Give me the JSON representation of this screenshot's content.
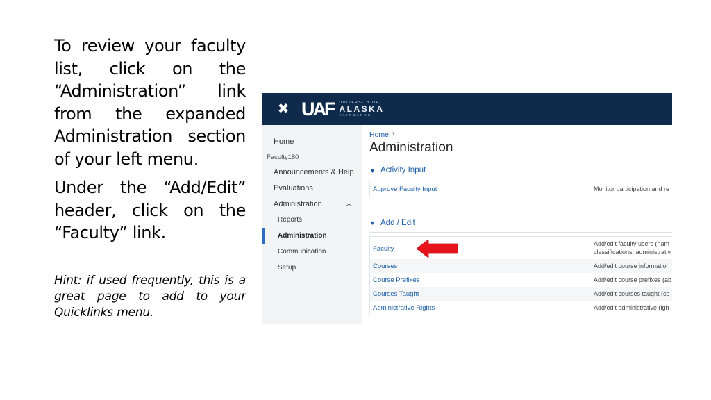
{
  "instructions": {
    "p1": "To review your faculty list, click on the “Administration” link from the expanded Administration section of your left menu.",
    "p2": "Under the “Add/Edit” header, click on the “Faculty” link.",
    "hint": "Hint: if used frequently, this is a great page to add to your Quicklinks menu."
  },
  "screenshot": {
    "header": {
      "close_icon": "✖",
      "logo_mark": "UAF",
      "logo_university": "UNIVERSITY OF",
      "logo_name": "ALASKA",
      "logo_city": "FAIRBANKS"
    },
    "sidebar": {
      "home": "Home",
      "group": "Faculty180",
      "announcements": "Announcements & Help",
      "evaluations": "Evaluations",
      "administration": "Administration",
      "chevron": "︿",
      "sub_items": [
        "Reports",
        "Administration",
        "Communication",
        "Setup"
      ]
    },
    "content": {
      "breadcrumb_home": "Home",
      "breadcrumb_sep": "›",
      "title": "Administration",
      "section1": {
        "title": "Activity Input",
        "rows": [
          {
            "link": "Approve Faculty Input",
            "desc": "Monitor participation and re"
          }
        ]
      },
      "section2": {
        "title": "Add / Edit",
        "rows": [
          {
            "link": "Faculty",
            "desc": "Add/edit faculty users (nam",
            "desc2": "classifications, administrativ"
          },
          {
            "link": "Courses",
            "desc": "Add/edit course information"
          },
          {
            "link": "Course Prefixes",
            "desc": "Add/edit course prefixes (ab"
          },
          {
            "link": "Courses Taught",
            "desc": "Add/edit courses taught (co"
          },
          {
            "link": "Administrative Rights",
            "desc": "Add/edit administrative righ"
          }
        ]
      }
    },
    "colors": {
      "header_bg": "#0f2a4a",
      "link": "#1f5fa8",
      "arrow": "#e8141c"
    }
  }
}
